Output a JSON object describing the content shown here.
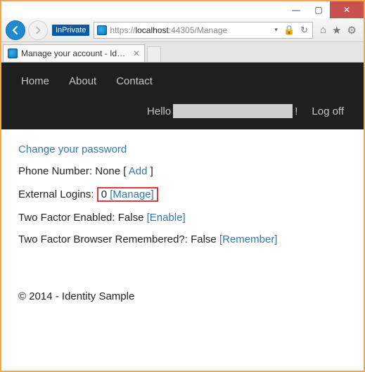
{
  "window": {
    "minimize": "—",
    "maximize": "▢",
    "close": "✕"
  },
  "browser": {
    "inprivate_label": "InPrivate",
    "url_display": "https://localhost:44305/Manage",
    "url_proto": "https://",
    "url_host": "localhost",
    "url_port_path": ":44305/Manage",
    "tab_title": "Manage your account - Ide..."
  },
  "nav": {
    "home": "Home",
    "about": "About",
    "contact": "Contact",
    "hello_prefix": "Hello",
    "hello_suffix": "!",
    "logoff": "Log off"
  },
  "page": {
    "change_password": "Change your password",
    "phone_label": "Phone Number:",
    "phone_value": "None",
    "phone_add": "Add",
    "ext_logins_label": "External Logins:",
    "ext_logins_count": "0",
    "ext_logins_manage": "[Manage]",
    "two_factor_label": "Two Factor Enabled:",
    "two_factor_value": "False",
    "two_factor_enable": "[Enable]",
    "browser_remembered_label": "Two Factor Browser Remembered?:",
    "browser_remembered_value": "False",
    "browser_remembered_link": "[Remember]",
    "footer": "© 2014 - Identity Sample"
  }
}
